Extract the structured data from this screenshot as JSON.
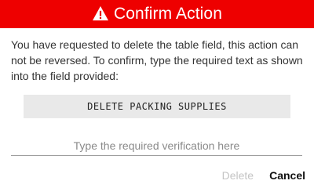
{
  "dialog": {
    "title": "Confirm Action",
    "header_color": "#ee0000",
    "header_icon": "warning-triangle-icon",
    "message": "You have requested to delete the table field, this action can not be reversed. To confirm, type the required text as shown into the field provided:",
    "required_text": "DELETE PACKING SUPPLIES",
    "input": {
      "value": "",
      "placeholder": "Type the required verification here"
    },
    "buttons": {
      "delete_label": "Delete",
      "delete_disabled": true,
      "cancel_label": "Cancel"
    }
  }
}
